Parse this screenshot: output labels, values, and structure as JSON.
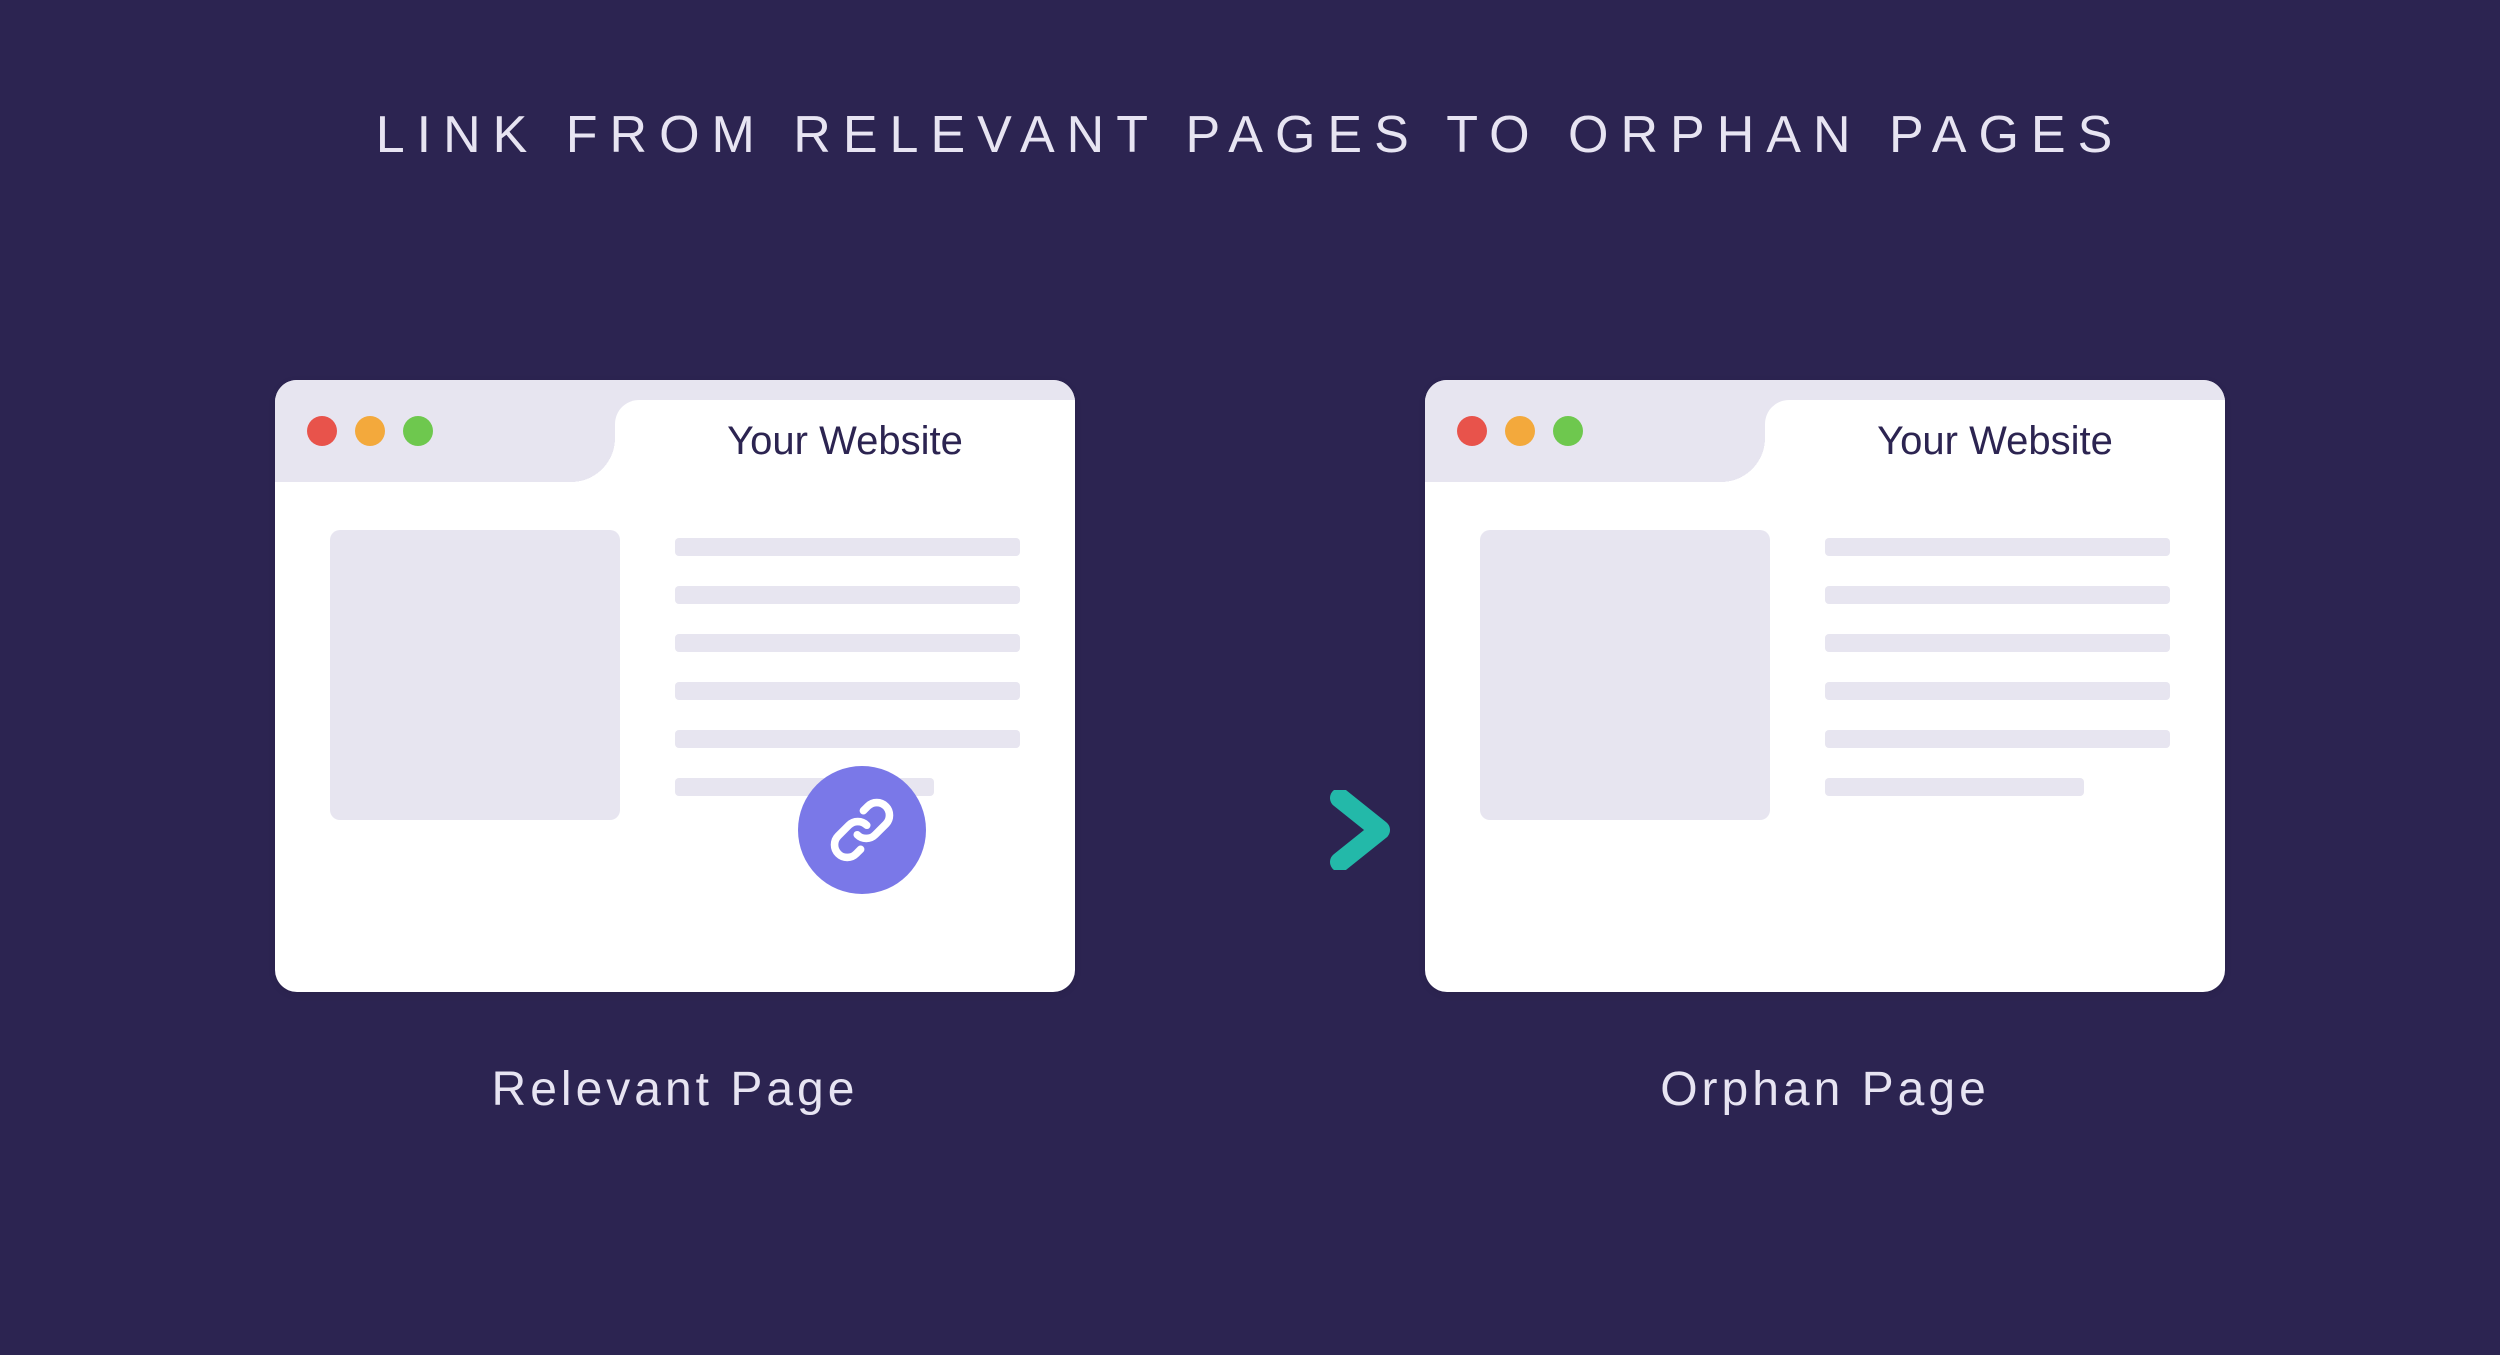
{
  "title": "LINK FROM RELEVANT PAGES TO ORPHAN PAGES",
  "left": {
    "tab": "Your Website",
    "caption": "Relevant Page"
  },
  "right": {
    "tab": "Your Website",
    "caption": "Orphan Page"
  },
  "icon": "link-icon",
  "colors": {
    "background": "#2c2451",
    "browser_chrome": "#e7e5f0",
    "badge": "#7a78e8",
    "arrow_start": "#6a5cd6",
    "arrow_end": "#23b9a9",
    "dot_red": "#e8534b",
    "dot_yellow": "#f3a93c",
    "dot_green": "#6ec84e"
  }
}
